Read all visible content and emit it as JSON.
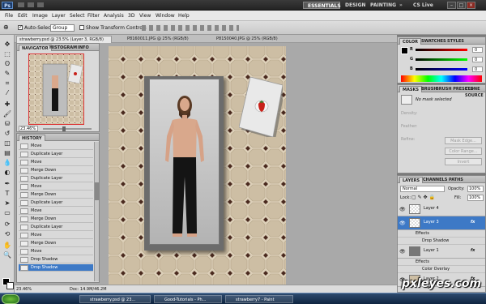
{
  "app": {
    "logo": "Ps",
    "workspaces": [
      "ESSENTIALS",
      "DESIGN",
      "PAINTING",
      "»"
    ],
    "cs_live": "CS Live"
  },
  "menu": [
    "File",
    "Edit",
    "Image",
    "Layer",
    "Select",
    "Filter",
    "Analysis",
    "3D",
    "View",
    "Window",
    "Help"
  ],
  "options": {
    "auto_select_label": "Auto-Select:",
    "auto_select_value": "Group",
    "transform_label": "Show Transform Controls"
  },
  "doc_tabs": [
    "strawberry.psd @ 23.5% (Layer 3, RGB/8)",
    "P8160011.JPG @ 25% (RGB/8)",
    "P8150040.JPG @ 25% (RGB/8)"
  ],
  "status": {
    "zoom": "23.46%",
    "doc": "Doc: 14.9M/46.2M"
  },
  "navigator": {
    "tabs": [
      "NAVIGATOR",
      "HISTOGRAM",
      "INFO"
    ],
    "zoom": "23.46%"
  },
  "history": {
    "tab": "HISTORY",
    "items": [
      "Move",
      "Duplicate Layer",
      "Move",
      "Merge Down",
      "Duplicate Layer",
      "Move",
      "Merge Down",
      "Duplicate Layer",
      "Move",
      "Merge Down",
      "Duplicate Layer",
      "Move",
      "Merge Down",
      "Move",
      "Drop Shadow",
      "Drop Shadow"
    ],
    "selected_index": 15
  },
  "color": {
    "tabs": [
      "COLOR",
      "SWATCHES",
      "STYLES"
    ],
    "channels": [
      {
        "label": "R",
        "value": "0"
      },
      {
        "label": "G",
        "value": "0"
      },
      {
        "label": "B",
        "value": "0"
      }
    ]
  },
  "masks": {
    "tabs": [
      "MASKS",
      "BRUSH",
      "BRUSH PRESETS",
      "CLONE SOURCE"
    ],
    "title": "No mask selected",
    "fields": [
      "Density:",
      "Feather:",
      "Refine:"
    ],
    "buttons": [
      "Mask Edge...",
      "Color Range...",
      "Invert"
    ]
  },
  "layers": {
    "tabs": [
      "LAYERS",
      "CHANNELS",
      "PATHS"
    ],
    "blend": "Normal",
    "opacity_label": "Opacity:",
    "opacity": "100%",
    "lock_label": "Lock:",
    "fill_label": "Fill:",
    "fill": "100%",
    "rows": [
      {
        "name": "Layer 4",
        "fx": ""
      },
      {
        "name": "Layer 3",
        "fx": "fx"
      },
      {
        "name": "Layer 1",
        "fx": "fx"
      },
      {
        "name": "Layer 2",
        "fx": "fx"
      }
    ],
    "effects_label": "Effects",
    "drop_shadow": "Drop Shadow",
    "color_overlay": "Color Overlay"
  },
  "taskbar": {
    "items": [
      "strawberry.psd @ 23...",
      "Good-Tutorials - Ph...",
      "strawberry7 - Paint"
    ]
  },
  "watermark": "pxleyes.com"
}
